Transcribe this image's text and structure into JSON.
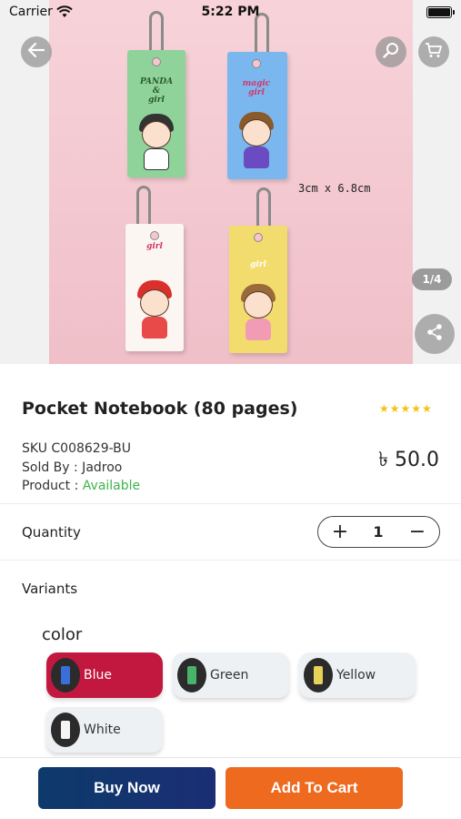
{
  "status_bar": {
    "carrier": "Carrier",
    "time": "5:22 PM"
  },
  "gallery": {
    "page_indicator": "1/4",
    "image_text": {
      "card1": "PANDA\n&\ngirl",
      "card2": "magic\ngirl",
      "card3": "girl",
      "card4": "girl",
      "size": "3cm x 6.8cm"
    },
    "icons": {
      "back": "back-arrow-icon",
      "search": "search-icon",
      "cart": "cart-icon",
      "share": "share-icon"
    }
  },
  "product": {
    "title": "Pocket Notebook (80 pages)",
    "rating_stars": "★★★★★",
    "sku": "SKU  C008629-BU",
    "seller_label": "Sold By :  Jadroo",
    "availability_label": "Product : ",
    "availability_value": "Available",
    "price": "৳ 50.0"
  },
  "quantity": {
    "label": "Quantity",
    "value": "1",
    "plus": "+",
    "minus": "−"
  },
  "variants": {
    "label": "Variants",
    "group_label": "color",
    "options": [
      {
        "label": "Blue",
        "selected": true,
        "swatch": "#3a6fd8"
      },
      {
        "label": "Green",
        "selected": false,
        "swatch": "#49b36a"
      },
      {
        "label": "Yellow",
        "selected": false,
        "swatch": "#e8d35a"
      },
      {
        "label": "White",
        "selected": false,
        "swatch": "#f4f4f4"
      }
    ]
  },
  "actions": {
    "buy_now": "Buy Now",
    "add_to_cart": "Add To Cart"
  },
  "colors": {
    "selected_chip": "#c2183f",
    "buy_now": "#0d3a6b",
    "add_to_cart": "#ee6a1f",
    "available": "#3cb44b",
    "stars": "#f1c40f"
  }
}
